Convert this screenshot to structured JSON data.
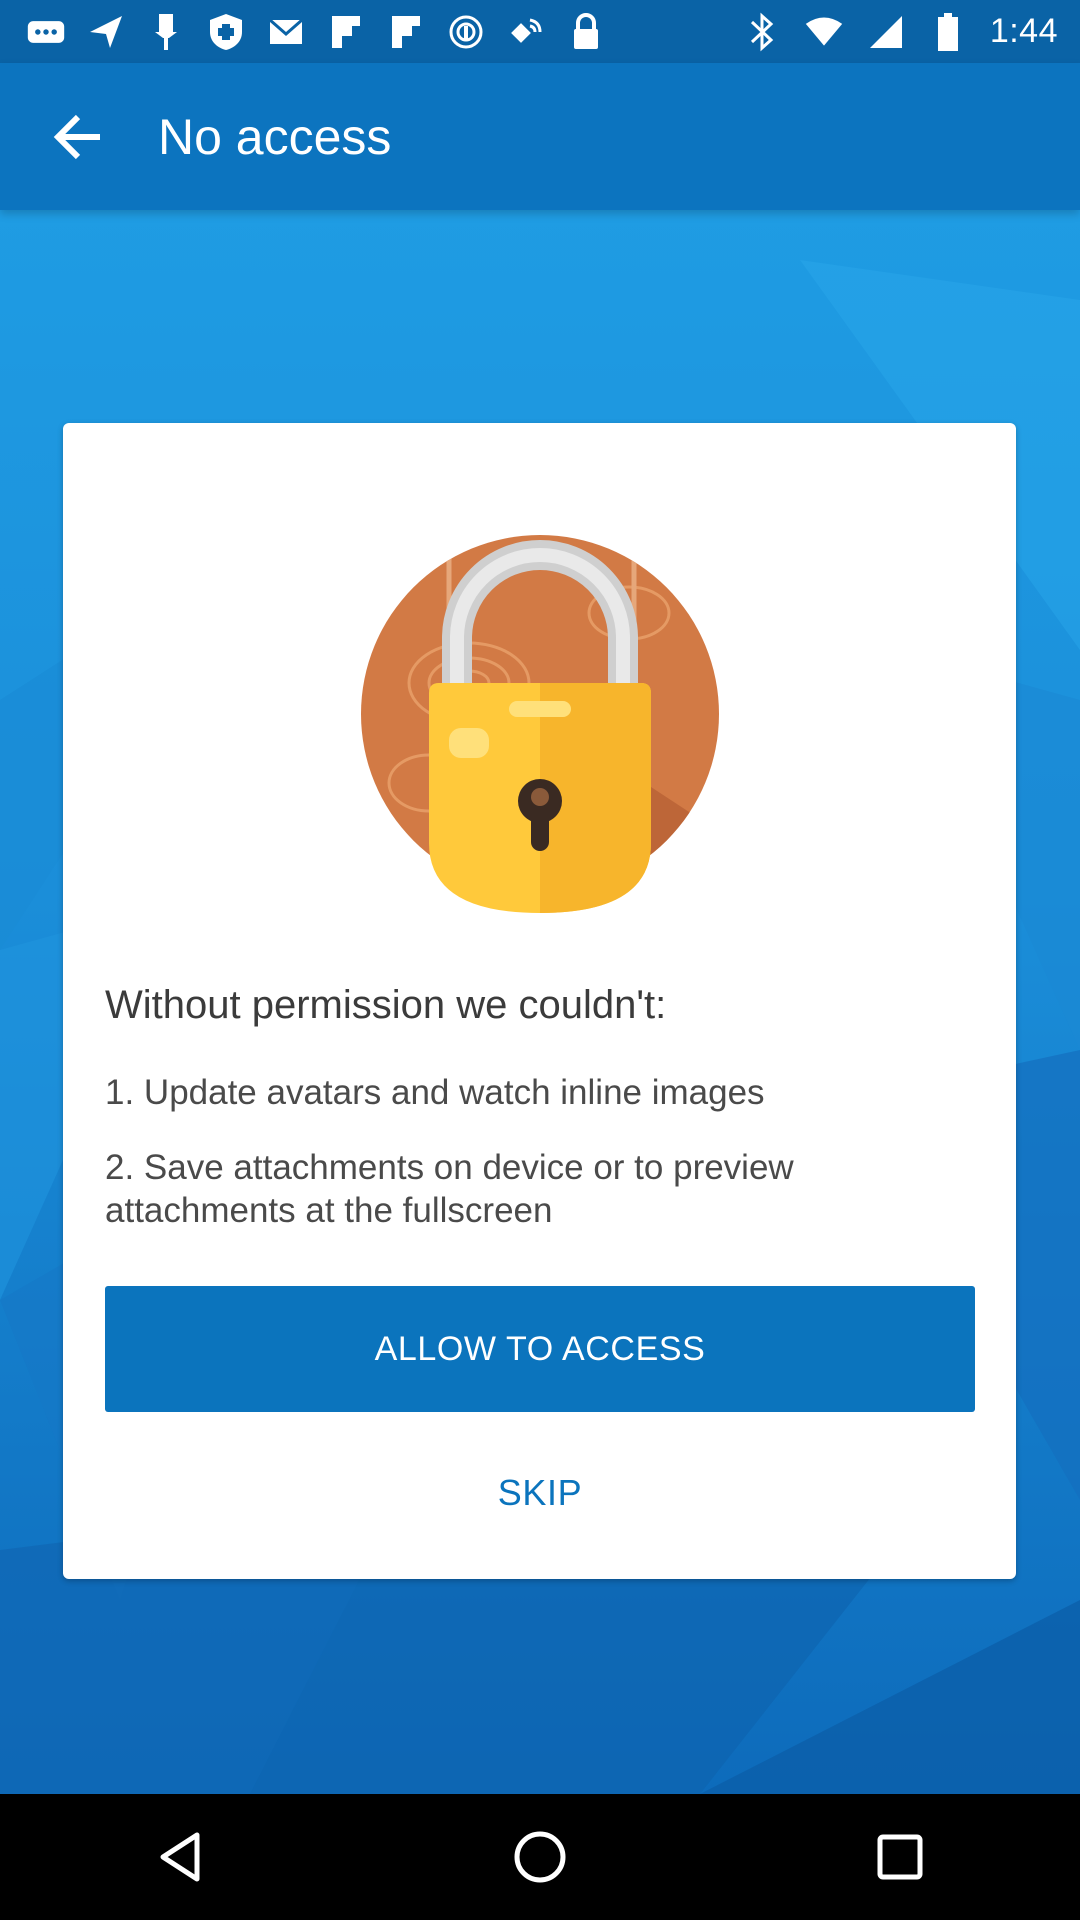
{
  "status_bar": {
    "time": "1:44",
    "icons_left": [
      "messages-icon",
      "send-icon",
      "pin-icon",
      "shield-icon",
      "mail-icon",
      "flipboard-icon",
      "flipboard-icon",
      "podcast-icon",
      "fake-gps-icon",
      "lock-icon"
    ],
    "icons_right": [
      "bluetooth-icon",
      "wifi-icon",
      "signal-icon",
      "battery-icon"
    ]
  },
  "app_bar": {
    "title": "No access",
    "back_icon": "arrow-back-icon"
  },
  "card": {
    "illustration": "padlock-icon",
    "heading": "Without permission we couldn't:",
    "items": [
      "1. Update avatars and watch inline images",
      "2. Save attachments on device or to preview attachments at the fullscreen"
    ],
    "allow_button": "ALLOW TO ACCESS",
    "skip_button": "SKIP"
  },
  "colors": {
    "status_bar": "#0a63a6",
    "app_bar": "#0c74bf",
    "accent": "#0b74bd",
    "background": "#1a86d0"
  },
  "nav_bar": {
    "buttons": [
      "back-triangle-icon",
      "home-circle-icon",
      "recents-square-icon"
    ]
  }
}
